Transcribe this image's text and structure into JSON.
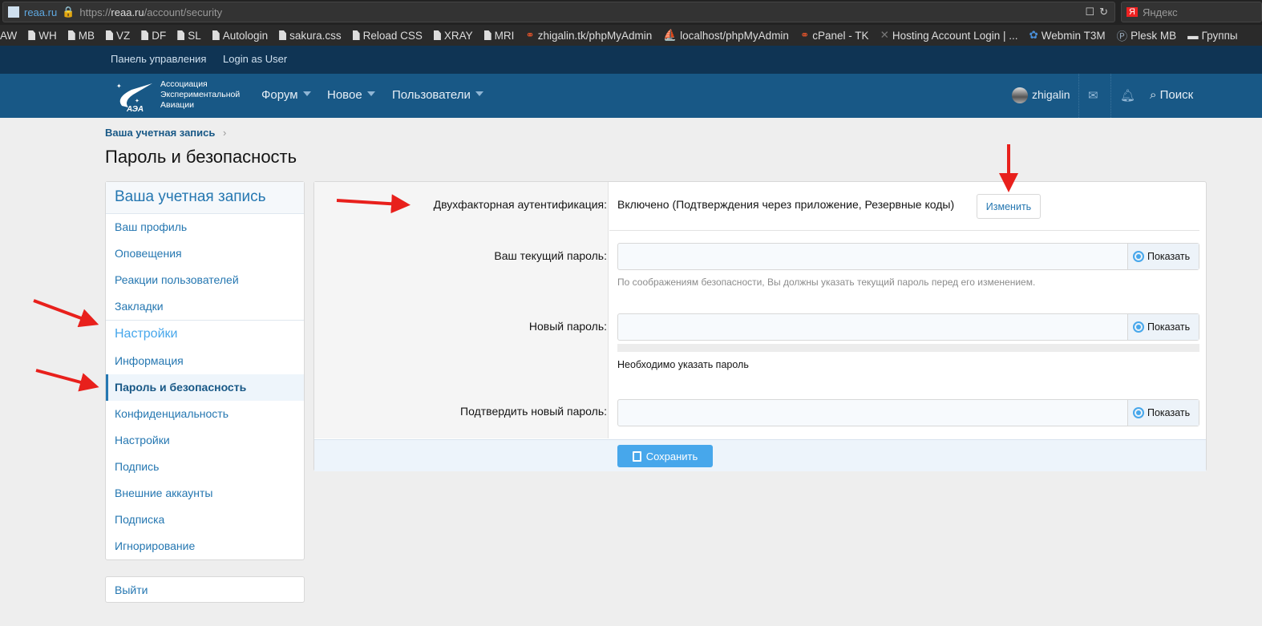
{
  "browser": {
    "site": "reaa.ru",
    "url_prefix": "https://",
    "url_domain": "reaa.ru",
    "url_path": "/account/security",
    "search_placeholder": "Яндекс",
    "bookmarks": [
      "AW",
      "WH",
      "MB",
      "VZ",
      "DF",
      "SL",
      "Autologin",
      "sakura.css",
      "Reload CSS",
      "XRAY",
      "MRI",
      "zhigalin.tk/phpMyAdmin",
      "localhost/phpMyAdmin",
      "cPanel - TK",
      "Hosting Account Login | ...",
      "Webmin T3M",
      "Plesk MB",
      "Группы"
    ]
  },
  "topnav": {
    "items": [
      "Панель управления",
      "Login as User"
    ]
  },
  "header": {
    "logo_lines": [
      "Ассоциация",
      "Экспериментальной",
      "Авиации"
    ],
    "logo_abbr": "АЭА",
    "nav": [
      "Форум",
      "Новое",
      "Пользователи"
    ],
    "user": "zhigalin",
    "search": "Поиск"
  },
  "breadcrumb": "Ваша учетная запись",
  "page_title": "Пароль и безопасность",
  "sidebar": {
    "header": "Ваша учетная запись",
    "items": [
      "Ваш профиль",
      "Оповещения",
      "Реакции пользователей",
      "Закладки"
    ],
    "section": "Настройки",
    "settings_items": [
      "Информация",
      "Пароль и безопасность",
      "Конфиденциальность",
      "Настройки",
      "Подпись",
      "Внешние аккаунты",
      "Подписка",
      "Игнорирование"
    ],
    "logout": "Выйти"
  },
  "form": {
    "twofa_label": "Двухфакторная аутентификация:",
    "twofa_value": "Включено (Подтверждения через приложение, Резервные коды)",
    "twofa_button": "Изменить",
    "current_label": "Ваш текущий пароль:",
    "current_hint": "По соображениям безопасности, Вы должны указать текущий пароль перед его изменением.",
    "new_label": "Новый пароль:",
    "new_hint": "Необходимо указать пароль",
    "confirm_label": "Подтвердить новый пароль:",
    "show_label": "Показать",
    "save_label": "Сохранить"
  },
  "colors": {
    "header": "#185886",
    "topnav": "#0f3454",
    "link": "#2577b1",
    "accent": "#47a7eb",
    "annotation": "#e8201c"
  }
}
